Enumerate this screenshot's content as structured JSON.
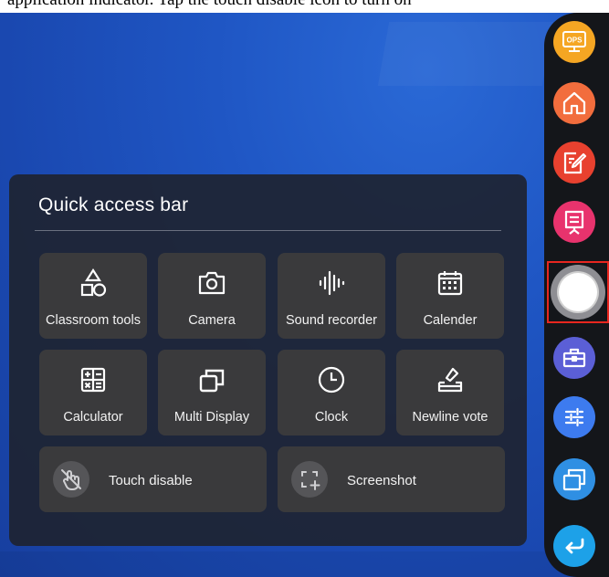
{
  "caption": {
    "text": "application indicator. Tap the touch disable icon to turn on"
  },
  "panel": {
    "title": "Quick access bar",
    "tiles": [
      {
        "label": "Classroom tools",
        "icon": "shapes-icon"
      },
      {
        "label": "Camera",
        "icon": "camera-icon"
      },
      {
        "label": "Sound recorder",
        "icon": "sound-wave-icon"
      },
      {
        "label": "Calender",
        "icon": "calendar-icon"
      },
      {
        "label": "Calculator",
        "icon": "calculator-icon"
      },
      {
        "label": "Multi Display",
        "icon": "multi-display-icon"
      },
      {
        "label": "Clock",
        "icon": "clock-icon"
      },
      {
        "label": "Newline vote",
        "icon": "vote-icon"
      }
    ],
    "wide_tiles": [
      {
        "label": "Touch disable",
        "icon": "touch-disable-icon"
      },
      {
        "label": "Screenshot",
        "icon": "screenshot-icon"
      }
    ]
  },
  "sidebar": {
    "buttons": [
      {
        "name": "ops",
        "icon": "ops-monitor-icon",
        "color": "#f5a623",
        "label": "OPS"
      },
      {
        "name": "home",
        "icon": "home-icon",
        "color": "#f26d3d"
      },
      {
        "name": "note",
        "icon": "edit-note-icon",
        "color": "#e8412f"
      },
      {
        "name": "presentation",
        "icon": "presentation-icon",
        "color": "#e8336d"
      },
      {
        "name": "quick-access",
        "icon": "circle-button-icon",
        "color": "#8e8e93"
      },
      {
        "name": "toolbox",
        "icon": "toolbox-icon",
        "color": "#5b5fd6"
      },
      {
        "name": "settings",
        "icon": "sliders-icon",
        "color": "#3d7bef"
      },
      {
        "name": "windows",
        "icon": "windows-icon",
        "color": "#2f8fe3"
      },
      {
        "name": "back",
        "icon": "back-arrow-icon",
        "color": "#1da1e8"
      }
    ]
  },
  "colors": {
    "desktop": "#1f56c4",
    "panel": "#1e2432",
    "tile": "#3a3a3c",
    "selection": "#e8261f"
  }
}
